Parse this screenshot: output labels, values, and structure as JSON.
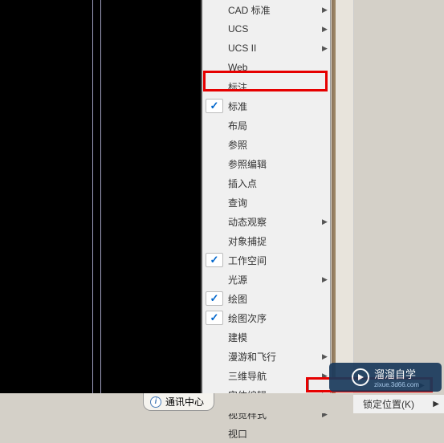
{
  "menu": {
    "items": [
      {
        "label": "CAD 标准",
        "checked": false,
        "arrow": true
      },
      {
        "label": "UCS",
        "checked": false,
        "arrow": true
      },
      {
        "label": "UCS II",
        "checked": false,
        "arrow": true
      },
      {
        "label": "Web",
        "checked": false,
        "arrow": false
      },
      {
        "label": "标注",
        "checked": false,
        "arrow": false
      },
      {
        "label": "标准",
        "checked": true,
        "arrow": false
      },
      {
        "label": "布局",
        "checked": false,
        "arrow": false
      },
      {
        "label": "参照",
        "checked": false,
        "arrow": false
      },
      {
        "label": "参照编辑",
        "checked": false,
        "arrow": false
      },
      {
        "label": "插入点",
        "checked": false,
        "arrow": false
      },
      {
        "label": "查询",
        "checked": false,
        "arrow": false
      },
      {
        "label": "动态观察",
        "checked": false,
        "arrow": true
      },
      {
        "label": "对象捕捉",
        "checked": false,
        "arrow": false
      },
      {
        "label": "工作空间",
        "checked": true,
        "arrow": false
      },
      {
        "label": "光源",
        "checked": false,
        "arrow": true
      },
      {
        "label": "绘图",
        "checked": true,
        "arrow": false
      },
      {
        "label": "绘图次序",
        "checked": true,
        "arrow": false
      },
      {
        "label": "建模",
        "checked": false,
        "arrow": false
      },
      {
        "label": "漫游和飞行",
        "checked": false,
        "arrow": true
      },
      {
        "label": "三维导航",
        "checked": false,
        "arrow": true
      },
      {
        "label": "实体编辑",
        "checked": false,
        "arrow": true
      },
      {
        "label": "视觉样式",
        "checked": false,
        "arrow": true
      },
      {
        "label": "视口",
        "checked": false,
        "arrow": false
      }
    ]
  },
  "comm_center": {
    "label": "通讯中心"
  },
  "submenu_right": {
    "label": "锁定位置(K)"
  },
  "watermark": {
    "brand": "溜溜自学",
    "url": "zixue.3d66.com"
  }
}
